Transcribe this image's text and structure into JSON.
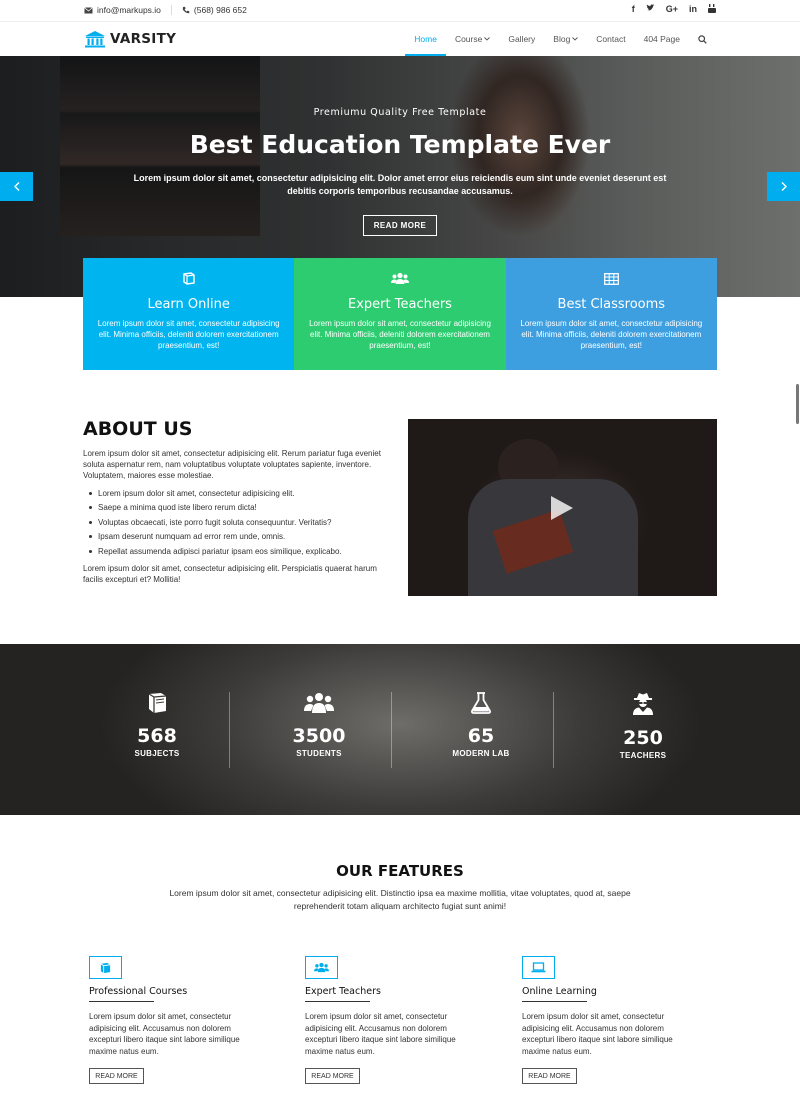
{
  "topbar": {
    "email": "info@markups.io",
    "phone": "(568) 986 652",
    "social": [
      "f",
      "t",
      "G+",
      "in",
      "yt"
    ]
  },
  "header": {
    "brand": "VARSITY",
    "nav": [
      {
        "label": "Home",
        "active": true
      },
      {
        "label": "Course",
        "dropdown": true
      },
      {
        "label": "Gallery"
      },
      {
        "label": "Blog",
        "dropdown": true
      },
      {
        "label": "Contact"
      },
      {
        "label": "404 Page"
      }
    ]
  },
  "hero": {
    "subtitle": "Premiumu Quality Free Template",
    "title": "Best Education Template Ever",
    "description": "Lorem ipsum dolor sit amet, consectetur adipisicing elit. Dolor amet error eius reiciendis eum sint unde eveniet deserunt est debitis corporis temporibus recusandae accusamus.",
    "button": "READ MORE"
  },
  "boxes": [
    {
      "title": "Learn Online",
      "text": "Lorem ipsum dolor sit amet, consectetur adipisicing elit. Minima officiis, deleniti dolorem exercitationem praesentium, est!",
      "color": "#00b4ef"
    },
    {
      "title": "Expert Teachers",
      "text": "Lorem ipsum dolor sit amet, consectetur adipisicing elit. Minima officiis, deleniti dolorem exercitationem praesentium, est!",
      "color": "#2ecc71"
    },
    {
      "title": "Best Classrooms",
      "text": "Lorem ipsum dolor sit amet, consectetur adipisicing elit. Minima officiis, deleniti dolorem exercitationem praesentium, est!",
      "color": "#3d9fe0"
    }
  ],
  "about": {
    "title": "ABOUT US",
    "intro": "Lorem ipsum dolor sit amet, consectetur adipisicing elit. Rerum pariatur fuga eveniet soluta aspernatur rem, nam voluptatibus voluptate voluptates sapiente, inventore. Voluptatem, maiores esse molestiae.",
    "list": [
      "Lorem ipsum dolor sit amet, consectetur adipisicing elit.",
      "Saepe a minima quod iste libero rerum dicta!",
      "Voluptas obcaecati, iste porro fugit soluta consequuntur. Veritatis?",
      "Ipsam deserunt numquam ad error rem unde, omnis.",
      "Repellat assumenda adipisci pariatur ipsam eos similique, explicabo."
    ],
    "outro": "Lorem ipsum dolor sit amet, consectetur adipisicing elit. Perspiciatis quaerat harum facilis excepturi et? Mollitia!"
  },
  "stats": [
    {
      "value": "568",
      "label": "SUBJECTS",
      "icon": "book-icon"
    },
    {
      "value": "3500",
      "label": "STUDENTS",
      "icon": "users-icon"
    },
    {
      "value": "65",
      "label": "MODERN LAB",
      "icon": "flask-icon"
    },
    {
      "value": "250",
      "label": "TEACHERS",
      "icon": "user-secret-icon"
    }
  ],
  "features": {
    "title": "OUR FEATURES",
    "description": "Lorem ipsum dolor sit amet, consectetur adipisicing elit. Distinctio ipsa ea maxime mollitia, vitae voluptates, quod at, saepe reprehenderit totam aliquam architecto fugiat sunt animi!",
    "items": [
      {
        "title": "Professional Courses",
        "text": "Lorem ipsum dolor sit amet, consectetur adipisicing elit. Accusamus non dolorem excepturi libero itaque sint labore similique maxime natus eum.",
        "button": "READ MORE"
      },
      {
        "title": "Expert Teachers",
        "text": "Lorem ipsum dolor sit amet, consectetur adipisicing elit. Accusamus non dolorem excepturi libero itaque sint labore similique maxime natus eum.",
        "button": "READ MORE"
      },
      {
        "title": "Online Learning",
        "text": "Lorem ipsum dolor sit amet, consectetur adipisicing elit. Accusamus non dolorem excepturi libero itaque sint labore similique maxime natus eum.",
        "button": "READ MORE"
      }
    ]
  }
}
